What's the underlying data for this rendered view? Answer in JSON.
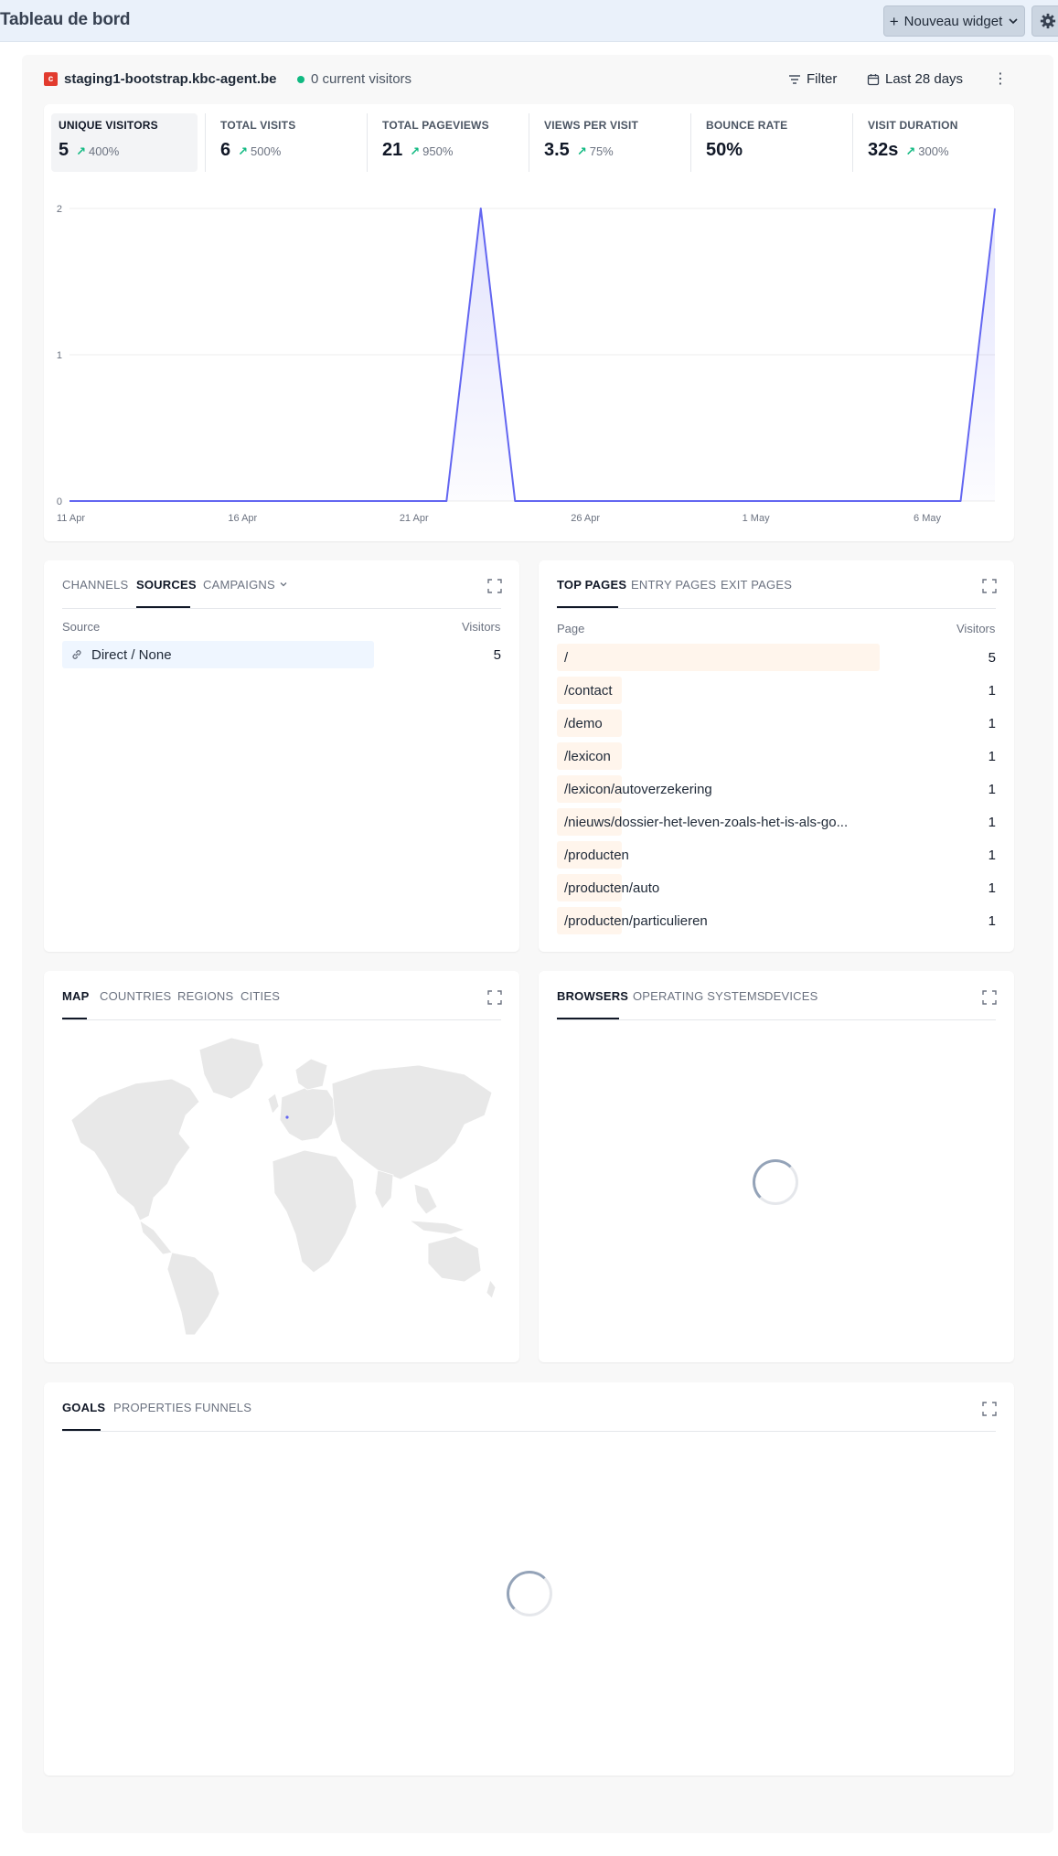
{
  "header": {
    "title": "Tableau de bord",
    "new_widget_label": "Nouveau widget"
  },
  "site": {
    "favicon_letter": "c",
    "name": "staging1-bootstrap.kbc-agent.be",
    "live_visitors": "0 current visitors",
    "filter_label": "Filter",
    "date_range_label": "Last 28 days"
  },
  "metrics": [
    {
      "label": "UNIQUE VISITORS",
      "value": "5",
      "change": "400%"
    },
    {
      "label": "TOTAL VISITS",
      "value": "6",
      "change": "500%"
    },
    {
      "label": "TOTAL PAGEVIEWS",
      "value": "21",
      "change": "950%"
    },
    {
      "label": "VIEWS PER VISIT",
      "value": "3.5",
      "change": "75%"
    },
    {
      "label": "BOUNCE RATE",
      "value": "50%",
      "change": ""
    },
    {
      "label": "VISIT DURATION",
      "value": "32s",
      "change": "300%"
    }
  ],
  "chart_data": {
    "type": "area",
    "x_tick_labels": [
      "11 Apr",
      "16 Apr",
      "21 Apr",
      "26 Apr",
      "1 May",
      "6 May"
    ],
    "y_tick_labels": [
      "0",
      "1",
      "2"
    ],
    "ylim": [
      0,
      2
    ],
    "series": [
      {
        "values": [
          0,
          0,
          0,
          0,
          0,
          0,
          0,
          0,
          0,
          0,
          0,
          0,
          2,
          0,
          0,
          0,
          0,
          0,
          0,
          0,
          0,
          0,
          0,
          0,
          0,
          0,
          0,
          2
        ]
      }
    ],
    "color": "#6366f1"
  },
  "sources_panel": {
    "tabs": [
      "CHANNELS",
      "SOURCES",
      "CAMPAIGNS"
    ],
    "active_tab": "SOURCES",
    "col_source": "Source",
    "col_visitors": "Visitors",
    "rows": [
      {
        "label": "Direct / None",
        "value": "5",
        "fraction": 1.0
      }
    ]
  },
  "pages_panel": {
    "tabs": [
      "TOP PAGES",
      "ENTRY PAGES",
      "EXIT PAGES"
    ],
    "active_tab": "TOP PAGES",
    "col_page": "Page",
    "col_visitors": "Visitors",
    "rows": [
      {
        "label": "/",
        "value": "5",
        "fraction": 1.0
      },
      {
        "label": "/contact",
        "value": "1",
        "fraction": 0.2
      },
      {
        "label": "/demo",
        "value": "1",
        "fraction": 0.2
      },
      {
        "label": "/lexicon",
        "value": "1",
        "fraction": 0.2
      },
      {
        "label": "/lexicon/autoverzekering",
        "value": "1",
        "fraction": 0.2
      },
      {
        "label": "/nieuws/dossier-het-leven-zoals-het-is-als-go...",
        "value": "1",
        "fraction": 0.2
      },
      {
        "label": "/producten",
        "value": "1",
        "fraction": 0.2
      },
      {
        "label": "/producten/auto",
        "value": "1",
        "fraction": 0.2
      },
      {
        "label": "/producten/particulieren",
        "value": "1",
        "fraction": 0.2
      }
    ]
  },
  "location_panel": {
    "tabs": [
      "MAP",
      "COUNTRIES",
      "REGIONS",
      "CITIES"
    ],
    "active_tab": "MAP"
  },
  "devices_panel": {
    "tabs": [
      "BROWSERS",
      "OPERATING SYSTEMS",
      "DEVICES"
    ],
    "active_tab": "BROWSERS"
  },
  "goals_panel": {
    "tabs": [
      "GOALS",
      "PROPERTIES",
      "FUNNELS"
    ],
    "active_tab": "GOALS"
  },
  "colors": {
    "accent": "#6366f1",
    "source_bar": "#eff6ff",
    "page_bar": "#fff5ec",
    "positive": "#10b981"
  }
}
